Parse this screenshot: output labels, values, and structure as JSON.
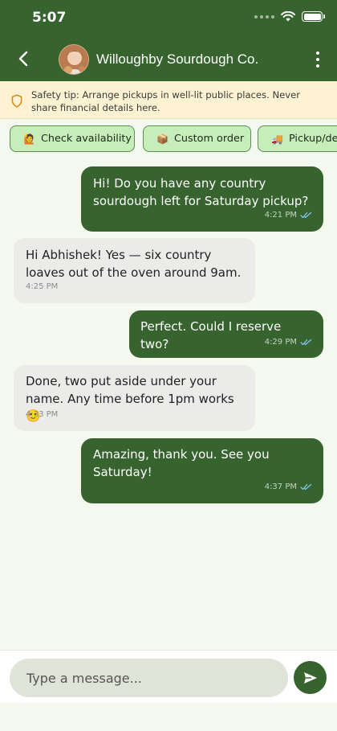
{
  "status_bar": {
    "time": "5:07"
  },
  "header": {
    "shop_name": "Willoughby Sourdough Co.",
    "back_icon": "chevron-left-icon",
    "more_icon": "vertical-ellipsis-icon",
    "avatar": "shop-avatar-photo"
  },
  "safety_banner": {
    "icon": "shield-icon",
    "text": "Safety tip: Arrange pickups in well-lit public places. Never share financial details here."
  },
  "quick_replies": [
    {
      "emoji": "🙋",
      "label": "Check availability"
    },
    {
      "emoji": "📦",
      "label": "Custom order"
    },
    {
      "emoji": "🚚",
      "label": "Pickup/delivery"
    }
  ],
  "messages": [
    {
      "direction": "out",
      "text": "Hi! Do you have any country sourdough left for Saturday pickup?",
      "time": "4:21 PM",
      "read": true
    },
    {
      "direction": "in",
      "text": "Hi Abhishek! Yes — six country loaves out of the oven around 9am.",
      "time": "4:25 PM"
    },
    {
      "direction": "out",
      "text": "Perfect. Could I reserve two?",
      "time": "4:29 PM",
      "read": true
    },
    {
      "direction": "in",
      "text": "Done, two put aside under your name. Any time before 1pm works 🙂",
      "time": "4:33 PM"
    },
    {
      "direction": "out",
      "text": "Amazing, thank you. See you Saturday!",
      "time": "4:37 PM",
      "read": true
    }
  ],
  "composer": {
    "placeholder": "Type a message...",
    "send_icon": "send-icon"
  },
  "colors": {
    "primary": "#37632f",
    "chip_bg": "#c6edba",
    "banner_bg": "#fdf3d2",
    "page_bg": "#f5f8ee",
    "incoming_bubble": "#ebebea",
    "read_tick": "#7fc3ec"
  }
}
